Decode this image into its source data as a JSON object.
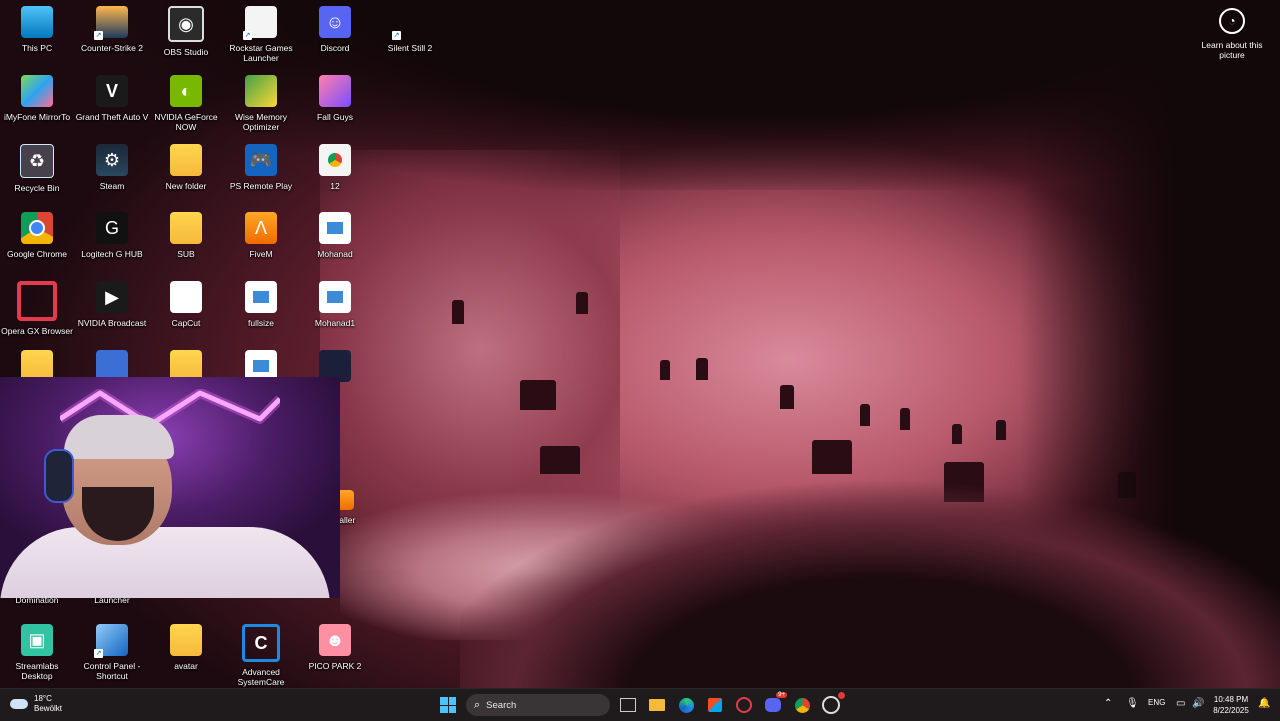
{
  "desktop": {
    "icons": [
      {
        "label": "This PC"
      },
      {
        "label": "Counter-Strike 2"
      },
      {
        "label": "OBS Studio"
      },
      {
        "label": "Rockstar Games Launcher"
      },
      {
        "label": "Discord"
      },
      {
        "label": "Silent Still 2"
      },
      {
        "label": "iMyFone MirrorTo"
      },
      {
        "label": "Grand Theft Auto V"
      },
      {
        "label": "NVIDIA GeForce NOW"
      },
      {
        "label": "Wise Memory Optimizer"
      },
      {
        "label": "Fall Guys"
      },
      {
        "label": "Recycle Bin"
      },
      {
        "label": "Steam"
      },
      {
        "label": "New folder"
      },
      {
        "label": "PS Remote Play"
      },
      {
        "label": "12"
      },
      {
        "label": "Google Chrome"
      },
      {
        "label": "Logitech G HUB"
      },
      {
        "label": "SUB"
      },
      {
        "label": "FiveM"
      },
      {
        "label": "Mohanad"
      },
      {
        "label": "Opera GX Browser"
      },
      {
        "label": "NVIDIA Broadcast"
      },
      {
        "label": "CapCut"
      },
      {
        "label": "fullsize"
      },
      {
        "label": "Mohanad1"
      },
      {
        "label": "Domination"
      },
      {
        "label": "Launcher"
      },
      {
        "label": "Streamlabs Desktop"
      },
      {
        "label": "Control Panel - Shortcut"
      },
      {
        "label": "avatar"
      },
      {
        "label": "Advanced SystemCare"
      },
      {
        "label": "PICO PARK 2"
      },
      {
        "label": "staller"
      }
    ],
    "learn_about_picture": "Learn about this picture"
  },
  "taskbar": {
    "weather": {
      "temp": "18°C",
      "condition": "Bewölkt"
    },
    "search_placeholder": "Search",
    "language": "ENG",
    "time": "10:48 PM",
    "date": "8/22/2025",
    "discord_badge": "9+"
  },
  "colors": {
    "taskbar_bg": "#1f1a1c",
    "start_accent": "#4cc2ff",
    "search_bg": "#3a3436"
  }
}
